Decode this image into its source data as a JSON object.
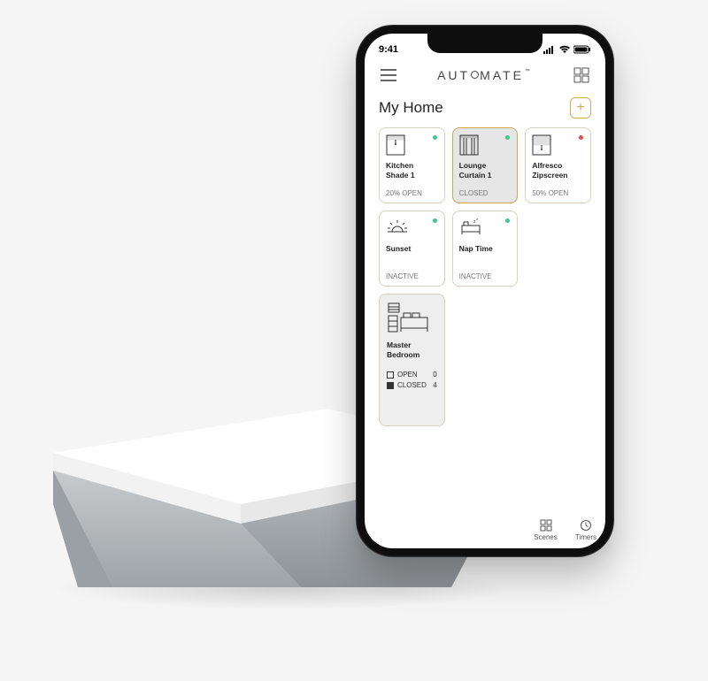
{
  "statusbar": {
    "time": "9:41"
  },
  "appbar": {
    "brand_pre": "AUT",
    "brand_post": "MATE"
  },
  "home": {
    "title": "My Home"
  },
  "tiles": [
    {
      "name": "Kitchen Shade 1",
      "status": "20% OPEN",
      "dot": "green",
      "icon": "shade",
      "selected": false
    },
    {
      "name": "Lounge Curtain 1",
      "status": "CLOSED",
      "dot": "green",
      "icon": "curtain",
      "selected": true
    },
    {
      "name": "Alfresco Zipscreen",
      "status": "50% OPEN",
      "dot": "red",
      "icon": "shade",
      "selected": false
    },
    {
      "name": "Sunset",
      "status": "INACTIVE",
      "dot": "green",
      "icon": "sunset",
      "selected": false
    },
    {
      "name": "Nap Time",
      "status": "INACTIVE",
      "dot": "green",
      "icon": "nap",
      "selected": false
    }
  ],
  "room": {
    "name": "Master Bedroom",
    "open_label": "OPEN",
    "open_count": "0",
    "closed_label": "CLOSED",
    "closed_count": "4",
    "dot": "green"
  },
  "bottom_nav": {
    "scenes": "Scenes",
    "timers": "Timers"
  }
}
